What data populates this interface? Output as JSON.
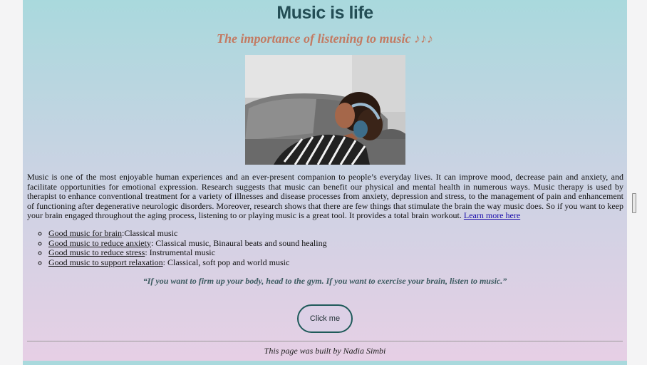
{
  "header": {
    "title": "Music is life",
    "subtitle": "The importance of listening to music ♪♪♪"
  },
  "hero_image": {
    "icon": "woman-relaxing-with-headphones-photo"
  },
  "intro": {
    "text": "Music is one of the most enjoyable human experiences and an ever-present companion to people’s everyday lives. It can improve mood, decrease pain and anxiety, and facilitate opportunities for emotional expression. Research suggests that music can benefit our physical and mental health in numerous ways. Music therapy is used by therapist to enhance conventional treatment for a variety of illnesses and disease processes from anxiety, depression and stress, to the management of pain and enhancement of functioning after degenerative neurologic disorders. Moreover, research shows that there are few things that stimulate the brain the way music does. So if you want to keep your brain engaged throughout the aging process, listening to or playing music is a great tool. It provides a total brain workout. ",
    "link_label": "Learn more here"
  },
  "tips": [
    {
      "link": "Good music for brain",
      "text": ":Classical music"
    },
    {
      "link": "Good music to reduce anxiety",
      "text": ": Classical music, Binaural beats and sound healing"
    },
    {
      "link": "Good music to reduce stress",
      "text": ": Instrumental music"
    },
    {
      "link": "Good music to support relaxation",
      "text": ": Classical, soft pop and world music"
    }
  ],
  "quote": "“If you want to firm up your body, head to the gym. If you want to exercise your brain, listen to music.”",
  "button": {
    "label": "Click me"
  },
  "footer": {
    "text": "This page was built by Nadia Simbi"
  },
  "colors": {
    "gradient_top": "#a9d9dd",
    "gradient_bottom": "#e7cfe5",
    "title": "#234d55",
    "subtitle": "#c37a62",
    "button_border": "#1f5a5a"
  }
}
